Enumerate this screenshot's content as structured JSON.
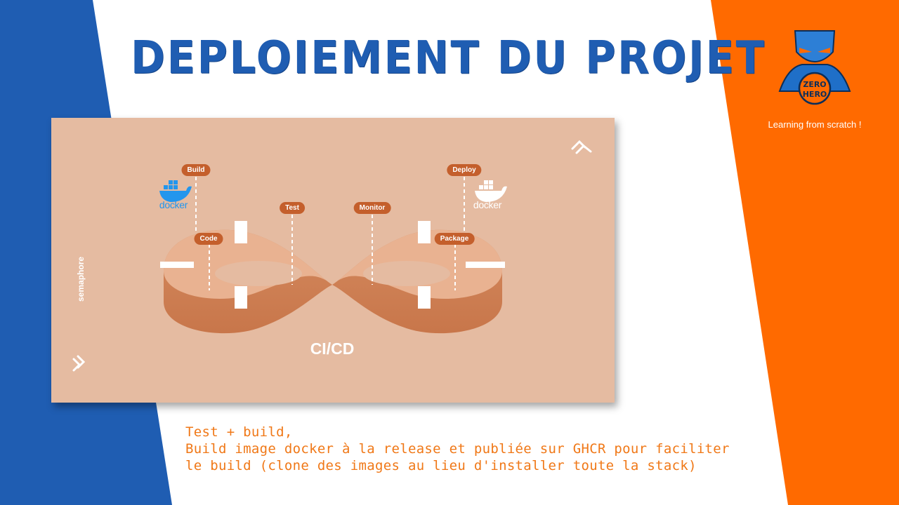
{
  "slide": {
    "title": "DEPLOIEMENT DU PROJET",
    "tagline": "Learning from scratch !",
    "logo_text": [
      "ZERO",
      "HERO"
    ],
    "colors": {
      "left_band": "#1f5db2",
      "right_band": "#ff6a00",
      "title": "#1f5db2",
      "caption": "#f07817"
    }
  },
  "diagram": {
    "center_label": "CI/CD",
    "brand": "semaphore",
    "stages": {
      "build": "Build",
      "code": "Code",
      "test": "Test",
      "monitor": "Monitor",
      "deploy": "Deploy",
      "package": "Package"
    },
    "docker_label": "docker",
    "icons": [
      "docker-icon",
      "semaphore-icon"
    ]
  },
  "caption": {
    "line1": "Test + build,",
    "line2": "Build image docker à la release et publiée sur GHCR pour faciliter",
    "line3": "le build (clone des images au lieu d'installer toute la stack)"
  }
}
